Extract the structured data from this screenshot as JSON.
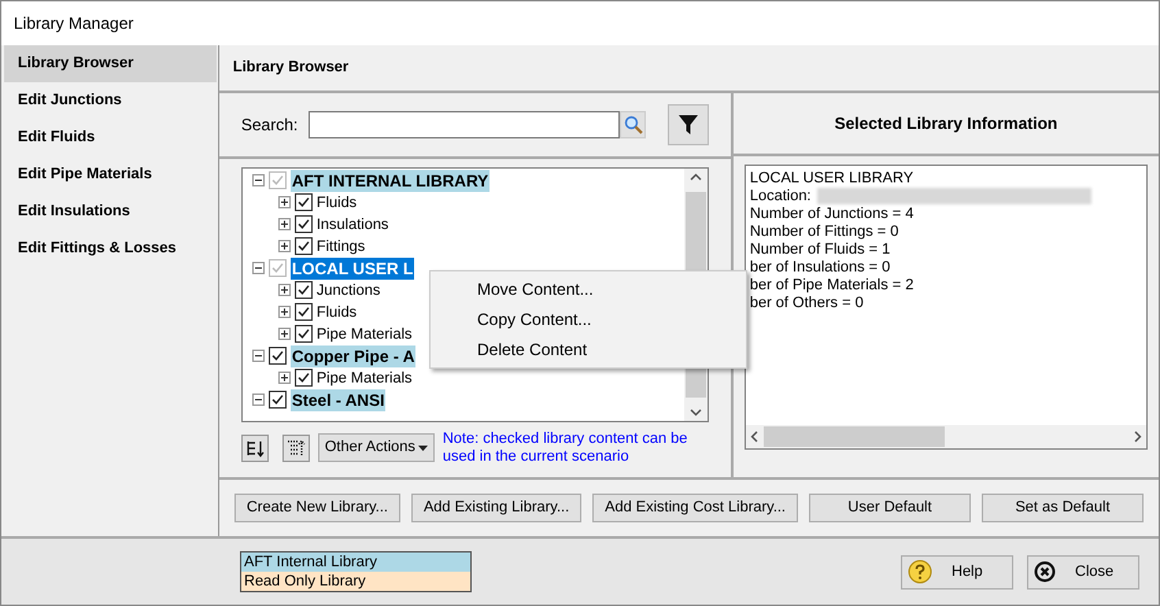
{
  "window": {
    "title": "Library Manager"
  },
  "sidebar": {
    "items": [
      {
        "label": "Library Browser",
        "selected": true
      },
      {
        "label": "Edit Junctions",
        "selected": false
      },
      {
        "label": "Edit Fluids",
        "selected": false
      },
      {
        "label": "Edit Pipe Materials",
        "selected": false
      },
      {
        "label": "Edit Insulations",
        "selected": false
      },
      {
        "label": "Edit Fittings & Losses",
        "selected": false
      }
    ]
  },
  "panel_title": "Library Browser",
  "search": {
    "label": "Search:"
  },
  "tree": [
    {
      "label": "AFT INTERNAL LIBRARY",
      "checked": true,
      "disabled": true,
      "expanded": true,
      "selected": false,
      "color": "#add8e6",
      "children": [
        {
          "label": "Fluids",
          "checked": true,
          "expanded": false
        },
        {
          "label": "Insulations",
          "checked": true,
          "expanded": false
        },
        {
          "label": "Fittings",
          "checked": true,
          "expanded": false
        }
      ]
    },
    {
      "label": "LOCAL USER L",
      "checked": true,
      "disabled": true,
      "expanded": true,
      "selected": true,
      "children": [
        {
          "label": "Junctions",
          "checked": true,
          "expanded": false
        },
        {
          "label": "Fluids",
          "checked": true,
          "expanded": false
        },
        {
          "label": "Pipe Materials",
          "checked": true,
          "expanded": false
        }
      ]
    },
    {
      "label": "Copper Pipe - A",
      "checked": true,
      "disabled": false,
      "expanded": true,
      "selected": false,
      "color": "#add8e6",
      "children": [
        {
          "label": "Pipe Materials",
          "checked": true,
          "expanded": false
        }
      ]
    },
    {
      "label": "Steel - ANSI",
      "checked": true,
      "disabled": false,
      "expanded": true,
      "selected": false,
      "color": "#add8e6"
    }
  ],
  "context_menu": [
    "Move Content...",
    "Copy Content...",
    "Delete Content"
  ],
  "other_actions": "Other Actions",
  "note": "Note: checked library content can be used in the current scenario",
  "info": {
    "title": "Selected Library Information",
    "lines": [
      "LOCAL USER LIBRARY",
      "Location:",
      "Number of Junctions = 4",
      "Number of Fittings = 0",
      "Number of Fluids = 1",
      "ber of Insulations = 0",
      "ber of Pipe Materials = 2",
      "ber of Others = 0"
    ]
  },
  "buttons": [
    "Create New Library...",
    "Add Existing Library...",
    "Add Existing Cost Library...",
    "User Default",
    "Set as Default"
  ],
  "legend": [
    {
      "label": "AFT Internal Library",
      "color": "#add8e6"
    },
    {
      "label": "Read Only Library",
      "color": "#ffe4c4"
    }
  ],
  "footer_buttons": [
    {
      "label": "Help",
      "kind": "help"
    },
    {
      "label": "Close",
      "kind": "close"
    }
  ]
}
